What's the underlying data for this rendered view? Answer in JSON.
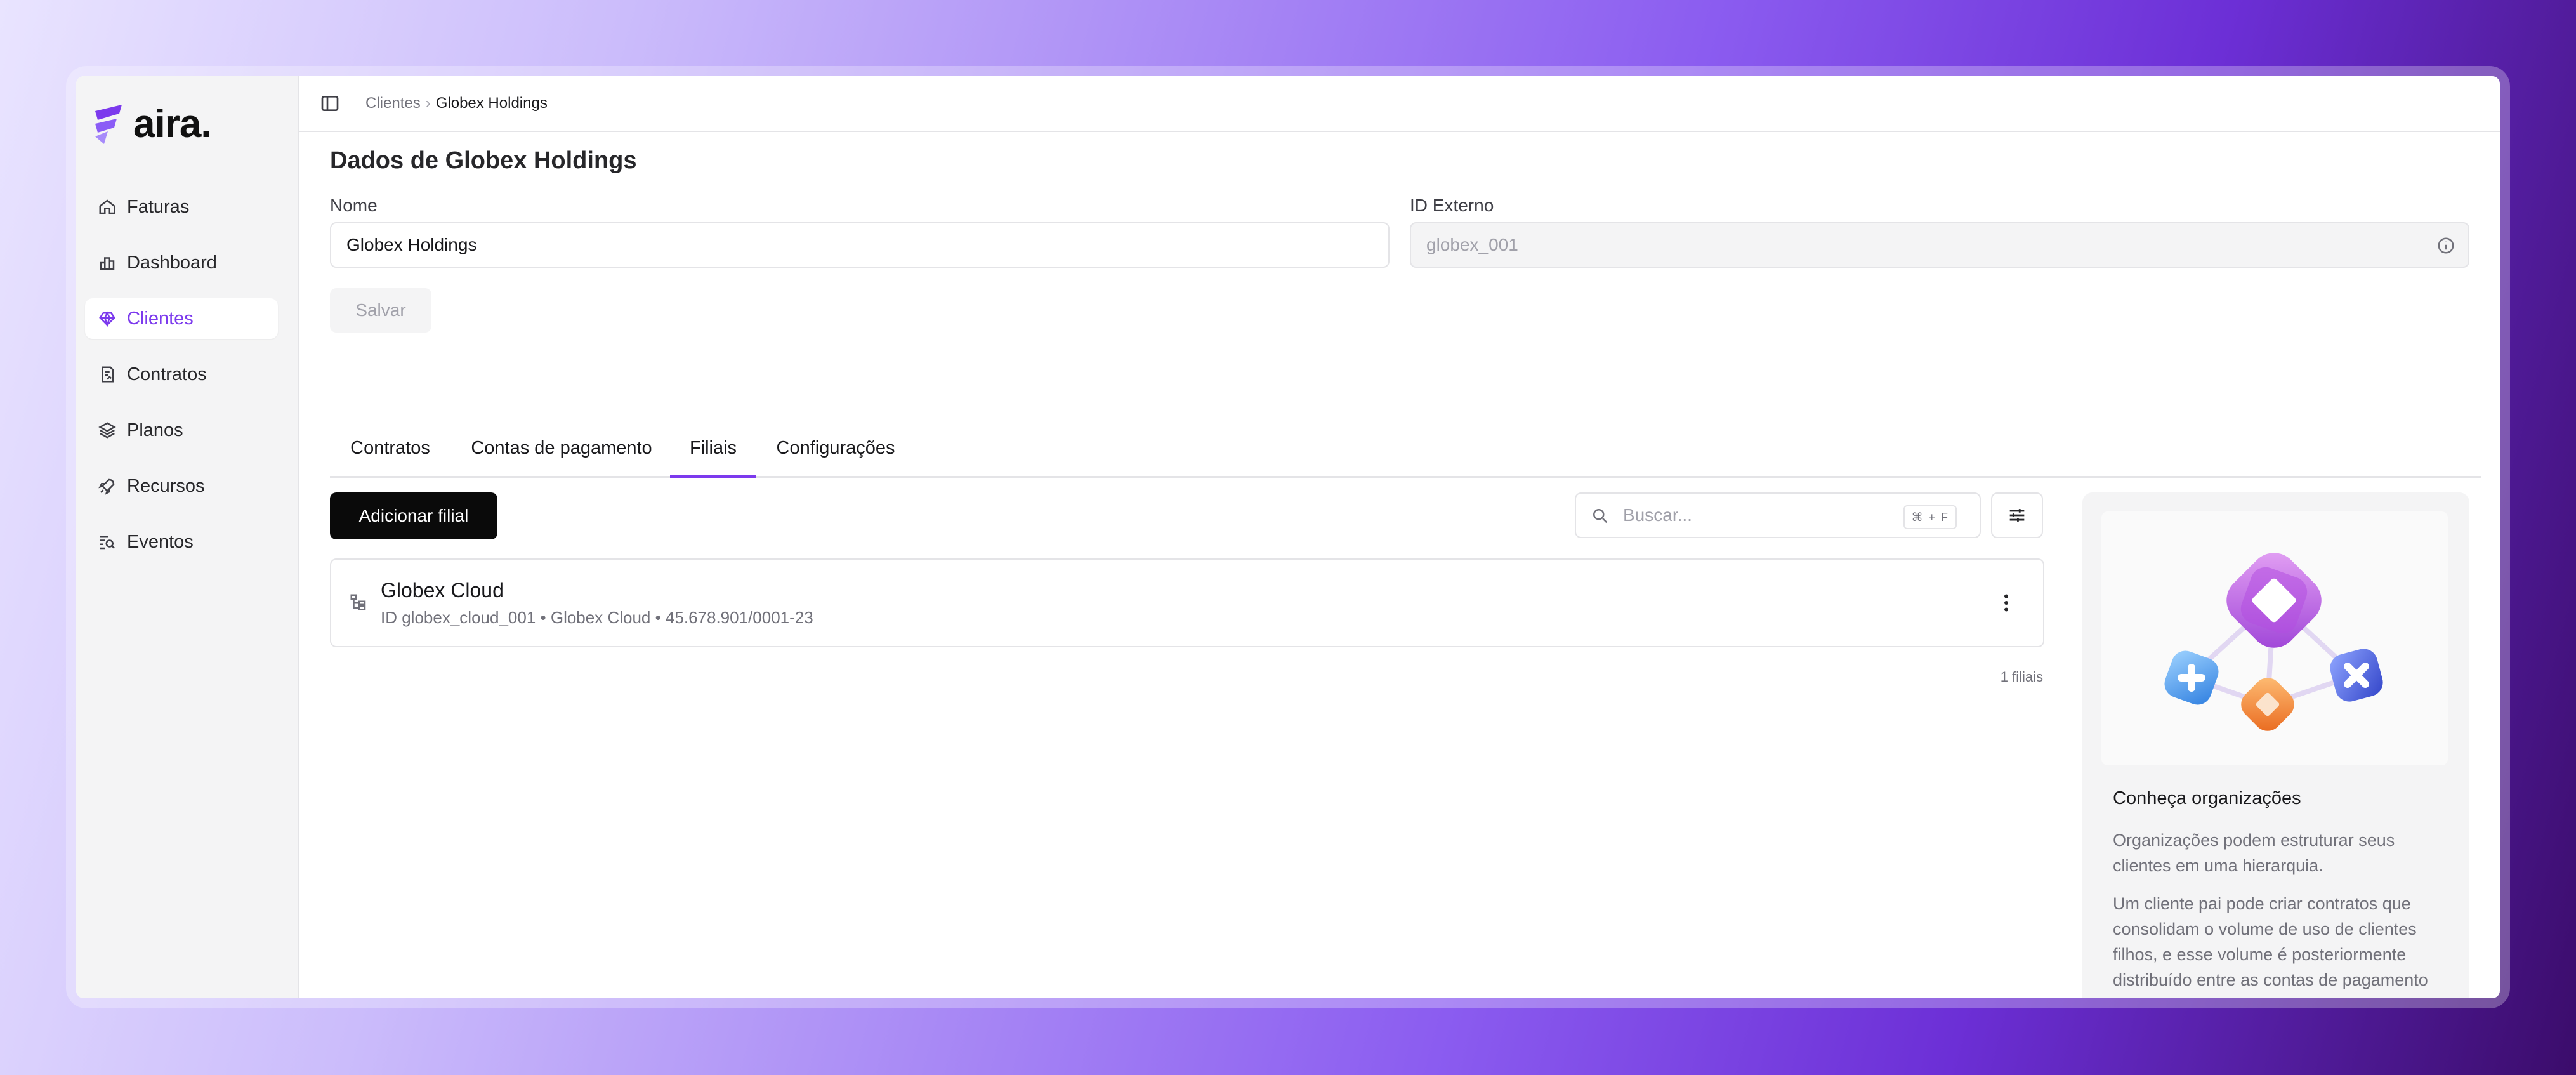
{
  "brand": {
    "name": "aira.",
    "accent": "#7c3aed"
  },
  "sidebar": {
    "items": [
      {
        "label": "Faturas",
        "icon": "home-icon"
      },
      {
        "label": "Dashboard",
        "icon": "bar-chart-icon"
      },
      {
        "label": "Clientes",
        "icon": "heart-gem-icon",
        "active": true
      },
      {
        "label": "Contratos",
        "icon": "contract-icon"
      },
      {
        "label": "Planos",
        "icon": "layers-icon"
      },
      {
        "label": "Recursos",
        "icon": "rocket-icon"
      },
      {
        "label": "Eventos",
        "icon": "event-search-icon"
      }
    ]
  },
  "breadcrumb": {
    "parent": "Clientes",
    "separator": "›",
    "current": "Globex Holdings"
  },
  "form": {
    "title": "Dados de Globex Holdings",
    "name_label": "Nome",
    "name_value": "Globex Holdings",
    "external_id_label": "ID Externo",
    "external_id_value": "globex_001",
    "save_label": "Salvar"
  },
  "tabs": [
    {
      "label": "Contratos"
    },
    {
      "label": "Contas de pagamento"
    },
    {
      "label": "Filiais",
      "active": true
    },
    {
      "label": "Configurações"
    }
  ],
  "toolbar": {
    "add_label": "Adicionar filial",
    "search_placeholder": "Buscar...",
    "search_shortcut": "⌘ + F"
  },
  "branches": [
    {
      "name": "Globex Cloud",
      "details": "ID globex_cloud_001 • Globex Cloud • 45.678.901/0001-23"
    }
  ],
  "branch_count": "1 filiais",
  "info_panel": {
    "title": "Conheça organizações",
    "paragraph1": "Organizações podem estruturar seus clientes em uma hierarquia.",
    "paragraph2": "Um cliente pai pode criar contratos que consolidam o volume de uso de clientes filhos, e esse volume é posteriormente distribuído entre as contas de pagamento desses clientes."
  }
}
